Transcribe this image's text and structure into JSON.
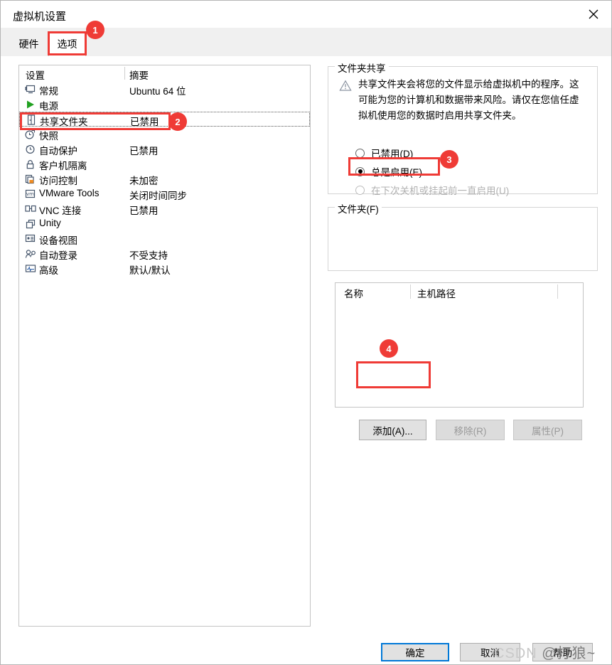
{
  "window": {
    "title": "虚拟机设置",
    "close_icon": "close-icon"
  },
  "tabs": [
    {
      "label": "硬件",
      "active": false
    },
    {
      "label": "选项",
      "active": true
    }
  ],
  "settings_list": {
    "columns": {
      "setting": "设置",
      "summary": "摘要"
    },
    "rows": [
      {
        "icon": "monitor-icon",
        "label": "常规",
        "summary": "Ubuntu 64 位",
        "selected": false
      },
      {
        "icon": "power-play-icon",
        "label": "电源",
        "summary": "",
        "selected": false
      },
      {
        "icon": "shared-folder-icon",
        "label": "共享文件夹",
        "summary": "已禁用",
        "selected": true
      },
      {
        "icon": "snapshot-clock-icon",
        "label": "快照",
        "summary": "",
        "selected": false
      },
      {
        "icon": "autoprotect-icon",
        "label": "自动保护",
        "summary": "已禁用",
        "selected": false
      },
      {
        "icon": "lock-icon",
        "label": "客户机隔离",
        "summary": "",
        "selected": false
      },
      {
        "icon": "access-control-icon",
        "label": "访问控制",
        "summary": "未加密",
        "selected": false
      },
      {
        "icon": "vmware-tools-icon",
        "label": "VMware Tools",
        "summary": "关闭时间同步",
        "selected": false
      },
      {
        "icon": "vnc-icon",
        "label": "VNC 连接",
        "summary": "已禁用",
        "selected": false
      },
      {
        "icon": "unity-icon",
        "label": "Unity",
        "summary": "",
        "selected": false
      },
      {
        "icon": "device-view-icon",
        "label": "设备视图",
        "summary": "",
        "selected": false
      },
      {
        "icon": "auto-login-icon",
        "label": "自动登录",
        "summary": "不受支持",
        "selected": false
      },
      {
        "icon": "advanced-icon",
        "label": "高级",
        "summary": "默认/默认",
        "selected": false
      }
    ]
  },
  "folder_sharing": {
    "legend": "文件夹共享",
    "warning_icon": "warning-triangle-icon",
    "warning_text": "共享文件夹会将您的文件显示给虚拟机中的程序。这可能为您的计算机和数据带来风险。请仅在您信任虚拟机使用您的数据时启用共享文件夹。",
    "options": [
      {
        "label": "已禁用(D)",
        "selected": false,
        "disabled": false
      },
      {
        "label": "总是启用(E)",
        "selected": true,
        "disabled": false
      },
      {
        "label": "在下次关机或挂起前一直启用(U)",
        "selected": false,
        "disabled": true
      }
    ]
  },
  "folders": {
    "legend": "文件夹(F)",
    "columns": [
      "名称",
      "主机路径"
    ],
    "rows": [],
    "buttons": [
      {
        "label": "添加(A)...",
        "disabled": false
      },
      {
        "label": "移除(R)",
        "disabled": true
      },
      {
        "label": "属性(P)",
        "disabled": true
      }
    ]
  },
  "dialog_buttons": {
    "ok": "确定",
    "cancel": "取消",
    "help": "帮助"
  },
  "annotations": [
    {
      "number": "1",
      "target": "选项 tab"
    },
    {
      "number": "2",
      "target": "共享文件夹 row"
    },
    {
      "number": "3",
      "target": "总是启用(E) radio"
    },
    {
      "number": "4",
      "target": "添加(A)... button"
    }
  ],
  "watermark": {
    "brand": "CSDN",
    "handle": "@打狼~"
  },
  "colors": {
    "accent_red": "#ef3b36",
    "focus_blue": "#0078d7",
    "panel_border": "#c4c4c4"
  }
}
